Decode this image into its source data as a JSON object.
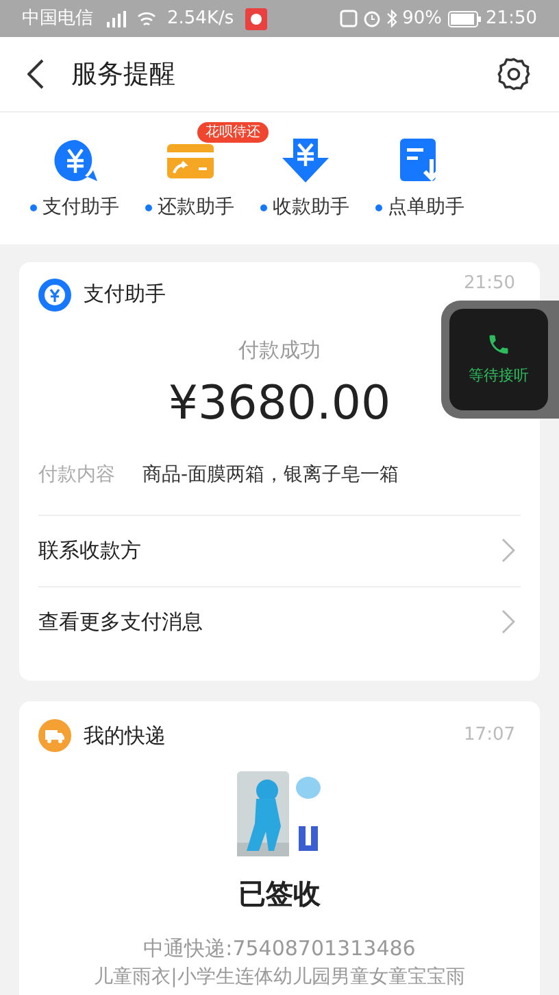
{
  "status_bar": {
    "carrier": "中国电信",
    "speed": "2.54K/s",
    "battery": "90%",
    "time": "21:50"
  },
  "header": {
    "title": "服务提醒"
  },
  "shortcuts": [
    {
      "label": "支付助手",
      "kind": "pay"
    },
    {
      "label": "还款助手",
      "kind": "repay",
      "badge": "花呗待还"
    },
    {
      "label": "收款助手",
      "kind": "receive"
    },
    {
      "label": "点单助手",
      "kind": "order"
    }
  ],
  "payment_card": {
    "title": "支付助手",
    "time": "21:50",
    "status": "付款成功",
    "amount": "¥3680.00",
    "detail_label": "付款内容",
    "detail_value": "商品-面膜两箱，银离子皂一箱",
    "links": [
      "联系收款方",
      "查看更多支付消息"
    ]
  },
  "call_overlay": {
    "label": "等待接听"
  },
  "delivery_card": {
    "title": "我的快递",
    "time": "17:07",
    "status": "已签收",
    "tracking": "中通快递:75408701313486",
    "item": "儿童雨衣|小学生连体幼儿园男童女童宝宝雨"
  }
}
